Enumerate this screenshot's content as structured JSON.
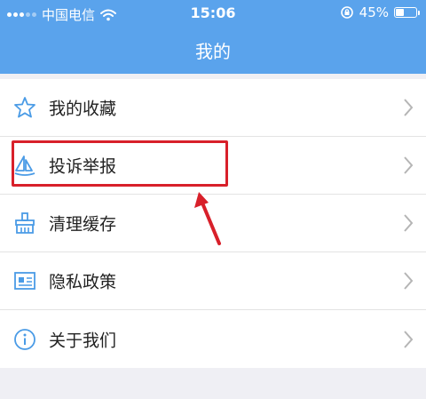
{
  "status_bar": {
    "carrier": "中国电信",
    "time": "15:06",
    "battery": "45%",
    "battery_level": 0.45
  },
  "header": {
    "title": "我的"
  },
  "menu": {
    "items": [
      {
        "label": "我的收藏",
        "icon": "star-icon"
      },
      {
        "label": "投诉举报",
        "icon": "sailboat-icon"
      },
      {
        "label": "清理缓存",
        "icon": "broom-icon"
      },
      {
        "label": "隐私政策",
        "icon": "id-card-icon"
      },
      {
        "label": "关于我们",
        "icon": "info-icon"
      }
    ]
  },
  "annotation": {
    "color": "#d8202a"
  },
  "colors": {
    "header": "#5aa3ec",
    "icon": "#4a9be6",
    "background": "#efeff4"
  }
}
